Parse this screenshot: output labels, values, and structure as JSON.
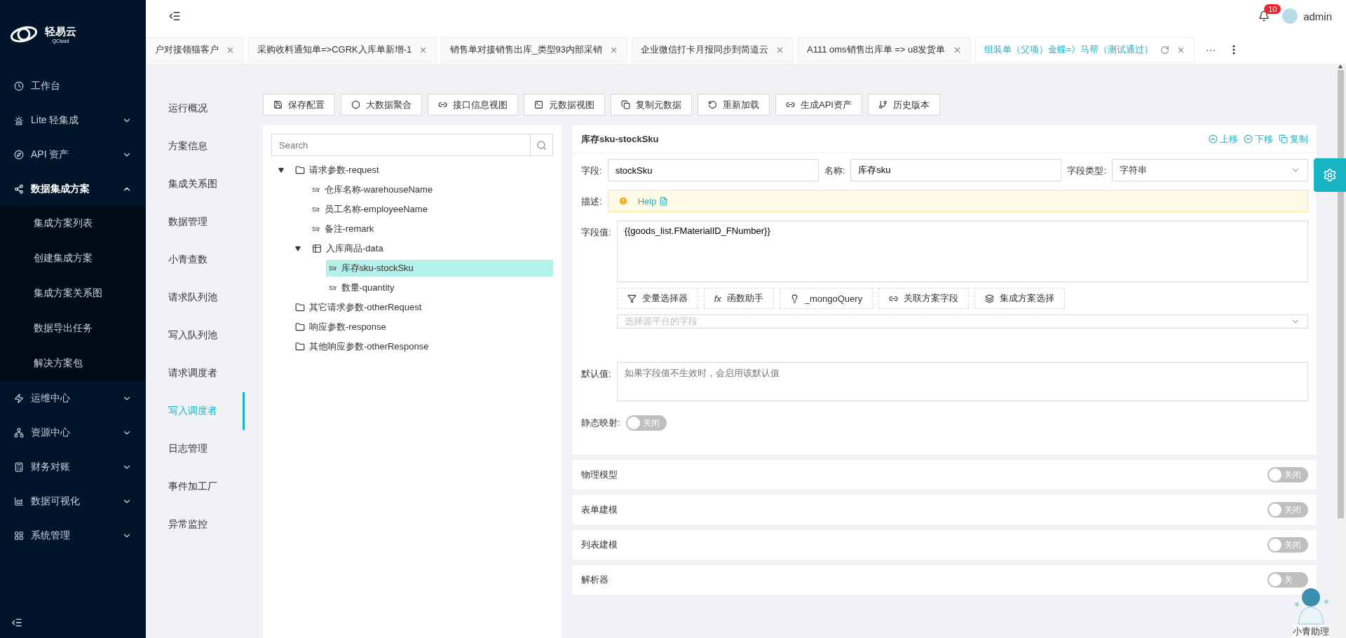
{
  "sidebar": {
    "logo": {
      "name": "轻易云",
      "sub": "QCloud"
    },
    "items": [
      {
        "label": "工作台",
        "expandable": false,
        "expanded": false
      },
      {
        "label": "Lite 轻集成",
        "expandable": true,
        "expanded": false
      },
      {
        "label": "API 资产",
        "expandable": true,
        "expanded": false
      },
      {
        "label": "数据集成方案",
        "expandable": true,
        "expanded": true,
        "children": [
          {
            "label": "集成方案列表"
          },
          {
            "label": "创建集成方案"
          },
          {
            "label": "集成方案关系图"
          },
          {
            "label": "数据导出任务"
          },
          {
            "label": "解决方案包"
          }
        ]
      },
      {
        "label": "运维中心",
        "expandable": true,
        "expanded": false
      },
      {
        "label": "资源中心",
        "expandable": true,
        "expanded": false
      },
      {
        "label": "财务对账",
        "expandable": true,
        "expanded": false
      },
      {
        "label": "数据可视化",
        "expandable": true,
        "expanded": false
      },
      {
        "label": "系统管理",
        "expandable": true,
        "expanded": false
      }
    ]
  },
  "header": {
    "notifications": "10",
    "user": "admin"
  },
  "tabs": [
    {
      "label": "户对接领猫客户",
      "selected": false
    },
    {
      "label": "采购收料通知单=>CGRK入库单新增-1",
      "selected": false
    },
    {
      "label": "销售单对接销售出库_类型93内部采销",
      "selected": false
    },
    {
      "label": "企业微信打卡月报同步到简道云",
      "selected": false
    },
    {
      "label": "A111 oms销售出库单 => u8发货单",
      "selected": false
    },
    {
      "label": "组装单（父项）金蝶=》马帮（测试通过）",
      "selected": true
    }
  ],
  "tabs_more": "···",
  "subnav": [
    {
      "label": "运行概况",
      "selected": false
    },
    {
      "label": "方案信息",
      "selected": false
    },
    {
      "label": "集成关系图",
      "selected": false
    },
    {
      "label": "数据管理",
      "selected": false
    },
    {
      "label": "小青查数",
      "selected": false
    },
    {
      "label": "请求队列池",
      "selected": false
    },
    {
      "label": "写入队列池",
      "selected": false
    },
    {
      "label": "请求调度者",
      "selected": false
    },
    {
      "label": "写入调度者",
      "selected": true
    },
    {
      "label": "日志管理",
      "selected": false
    },
    {
      "label": "事件加工厂",
      "selected": false
    },
    {
      "label": "异常监控",
      "selected": false
    }
  ],
  "toolbar": [
    "保存配置",
    "大数据聚合",
    "接口信息视图",
    "元数据视图",
    "复制元数据",
    "重新加载",
    "生成API资产",
    "历史版本"
  ],
  "tree": {
    "search_placeholder": "Search",
    "nodes": [
      {
        "kind": "folder",
        "label": "请求参数-request",
        "expanded": true,
        "selected": false,
        "children": [
          {
            "kind": "string",
            "tag": "Str",
            "label": "仓库名称-warehouseName",
            "selected": false
          },
          {
            "kind": "string",
            "tag": "Str",
            "label": "员工名称-employeeName",
            "selected": false
          },
          {
            "kind": "string",
            "tag": "Str",
            "label": "备注-remark",
            "selected": false
          },
          {
            "kind": "table",
            "label": "入库商品-data",
            "expanded": true,
            "selected": false,
            "children": [
              {
                "kind": "string",
                "tag": "Str",
                "label": "库存sku-stockSku",
                "selected": true
              },
              {
                "kind": "string",
                "tag": "Str",
                "label": "数量-quantity",
                "selected": false
              }
            ]
          }
        ]
      },
      {
        "kind": "folder",
        "label": "其它请求参数-otherRequest",
        "expanded": false,
        "selected": false
      },
      {
        "kind": "folder",
        "label": "响应参数-response",
        "expanded": false,
        "selected": false
      },
      {
        "kind": "folder",
        "label": "其他响应参数-otherResponse",
        "expanded": false,
        "selected": false
      }
    ]
  },
  "detail": {
    "title": "库存sku-stockSku",
    "actions": [
      "上移",
      "下移",
      "复制"
    ],
    "field": {
      "label": "字段:",
      "value": "stockSku"
    },
    "name": {
      "label": "名称:",
      "value": "库存sku"
    },
    "type": {
      "label": "字段类型:",
      "value": "字符串"
    },
    "description": {
      "label": "描述:",
      "link": "Help"
    },
    "value": {
      "label": "字段值:",
      "text": "{{goods_list.FMaterialID_FNumber}}"
    },
    "tools": [
      {
        "label": "变量选择器"
      },
      {
        "label": "函数助手",
        "glyph": "fx"
      },
      {
        "label": "_mongoQuery"
      },
      {
        "label": "关联方案字段"
      },
      {
        "label": "集成方案选择"
      }
    ],
    "source_placeholder": "选择源平台的字段",
    "default": {
      "label": "默认值:",
      "placeholder": "如果字段值不生效时，会启用该默认值"
    },
    "static_mapping": {
      "label": "静态映射:",
      "on": false,
      "text": "关闭"
    }
  },
  "sections": [
    {
      "title": "物理模型",
      "on": false,
      "text": "关闭"
    },
    {
      "title": "表单建模",
      "on": false,
      "text": "关闭"
    },
    {
      "title": "列表建模",
      "on": false,
      "text": "关闭"
    },
    {
      "title": "解析器",
      "on": false,
      "text": "关"
    }
  ],
  "assistant": {
    "label": "小青助理"
  }
}
